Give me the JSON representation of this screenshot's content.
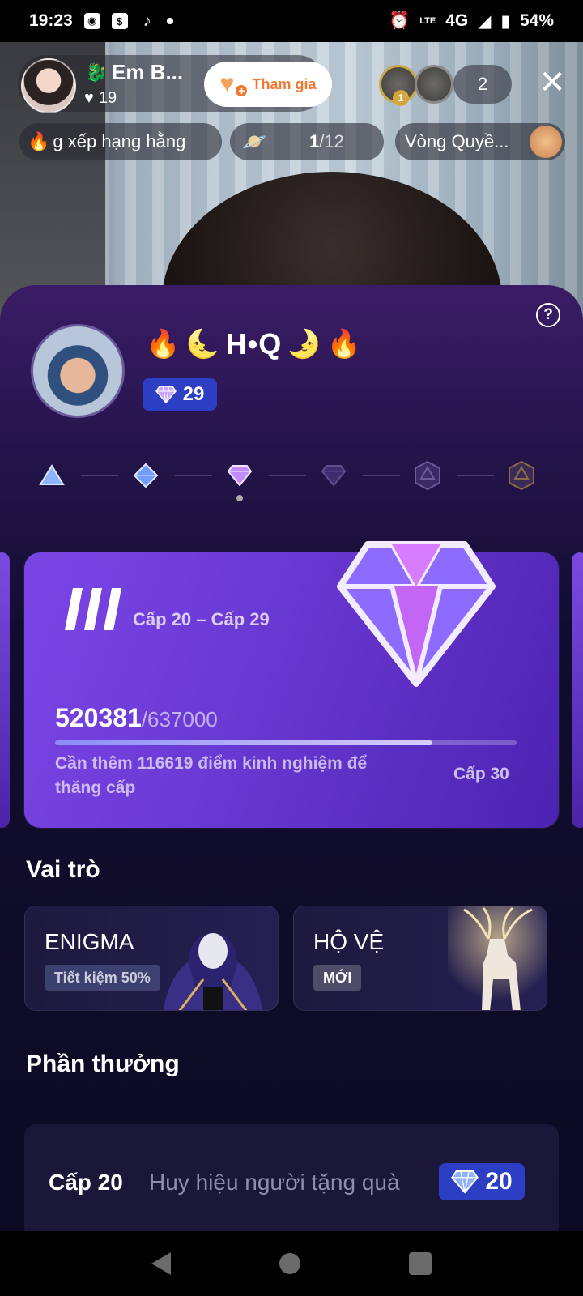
{
  "status_bar": {
    "time": "19:23",
    "network": "4G",
    "battery": "54%",
    "lte_label": "LTE"
  },
  "live": {
    "host_name": "Em B...",
    "host_likes": "19",
    "join_label": "Tham gia",
    "viewer_badge": "1",
    "viewer_count": "2",
    "chips": {
      "rank": "g xếp hạng hằng",
      "planet_current": "1",
      "planet_total": "/12",
      "round": "Vòng Quyề..."
    }
  },
  "sheet": {
    "user_name": "H•Q",
    "user_level": "29",
    "card": {
      "tier_roman": "III",
      "range": "Cấp 20 – Cấp 29",
      "current_xp": "520381",
      "max_xp": "/637000",
      "progress_fraction": 0.817,
      "hint": "Cần thêm 116619 điểm kinh nghiệm để thăng cấp",
      "next_level": "Cấp 30"
    },
    "roles_title": "Vai trò",
    "roles": [
      {
        "name": "ENIGMA",
        "tag": "Tiết kiệm 50%"
      },
      {
        "name": "HỘ VỆ",
        "tag": "MỚI"
      }
    ],
    "rewards_title": "Phần thưởng",
    "reward": {
      "level": "Cấp 20",
      "name": "Huy hiệu người tặng quà",
      "badge_value": "20"
    }
  },
  "colors": {
    "accent_blue": "#2b3ec4",
    "join_orange": "#f07830",
    "card_purple": "#7b45e6"
  }
}
